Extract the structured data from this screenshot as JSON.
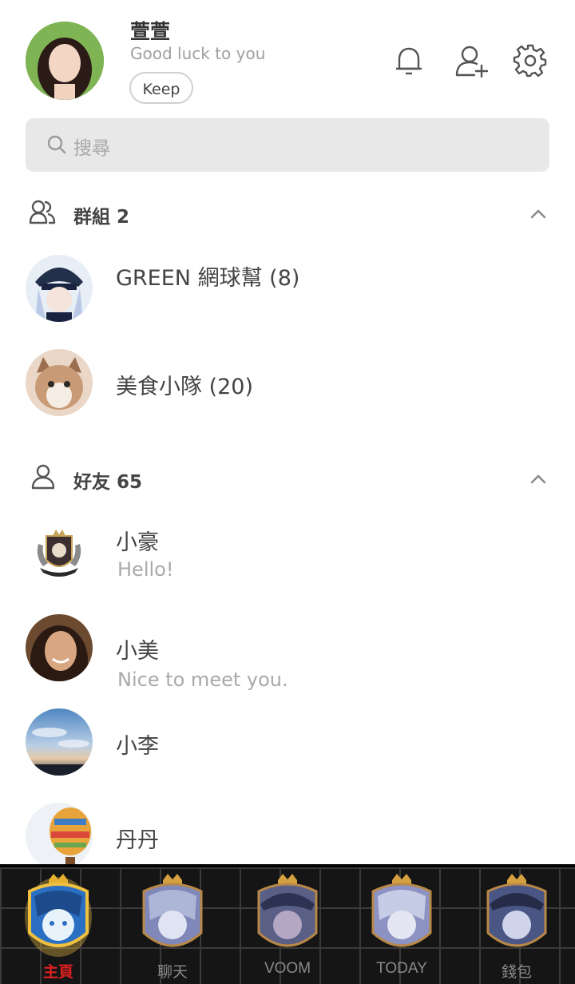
{
  "profile": {
    "name": "萱萱",
    "status": "Good luck to you",
    "keep_label": "Keep"
  },
  "header_icons": [
    "bell-icon",
    "add-friend-icon",
    "settings-gear-icon"
  ],
  "search": {
    "placeholder": "搜尋"
  },
  "groups": {
    "title": "群組 2",
    "items": [
      {
        "name": "GREEN 網球幫 (8)"
      },
      {
        "name": "美食小隊 (20)"
      }
    ]
  },
  "friends": {
    "title": "好友 65",
    "items": [
      {
        "name": "小豪",
        "status": "Hello!"
      },
      {
        "name": "小美",
        "status": "Nice to meet you."
      },
      {
        "name": "小李",
        "status": ""
      },
      {
        "name": "丹丹",
        "status": ""
      }
    ]
  },
  "tabs": [
    {
      "label": "主頁",
      "active": true
    },
    {
      "label": "聊天",
      "active": false
    },
    {
      "label": "VOOM",
      "active": false
    },
    {
      "label": "TODAY",
      "active": false
    },
    {
      "label": "錢包",
      "active": false
    }
  ],
  "colors": {
    "active_tab": "#e02020",
    "tabbar_bg": "#151515",
    "search_bg": "#e8e8e8"
  }
}
